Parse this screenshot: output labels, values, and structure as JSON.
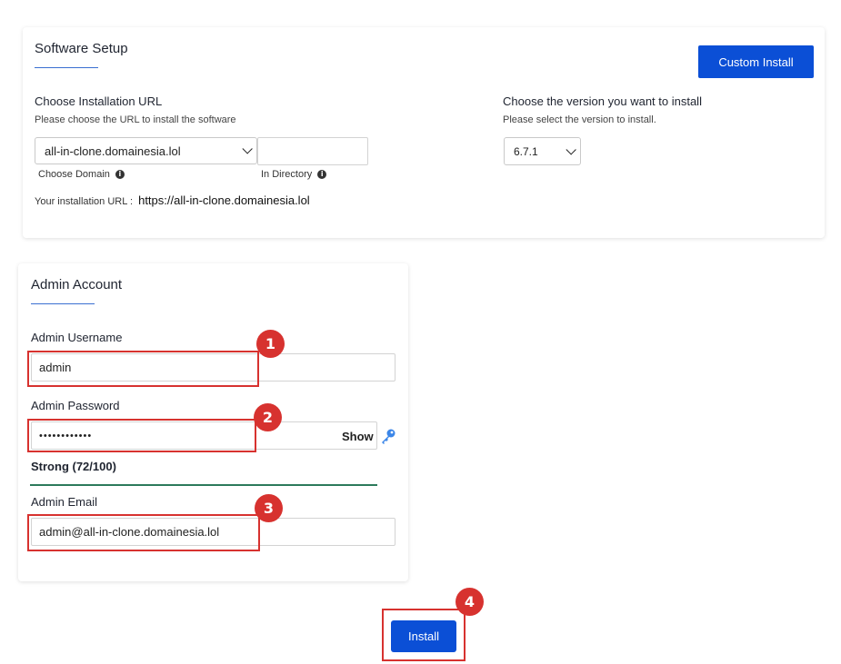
{
  "software_setup": {
    "title": "Software Setup",
    "custom_install_label": "Custom Install",
    "url_section": {
      "title": "Choose Installation URL",
      "subtitle": "Please choose the URL to install the software",
      "domain_value": "all-in-clone.domainesia.lol",
      "domain_label": "Choose Domain",
      "directory_value": "",
      "directory_label": "In Directory",
      "installation_url_label": "Your installation URL :",
      "installation_url": "https://all-in-clone.domainesia.lol"
    },
    "version_section": {
      "title": "Choose the version you want to install",
      "subtitle": "Please select the version to install.",
      "version_value": "6.7.1"
    }
  },
  "admin_account": {
    "title": "Admin Account",
    "username_label": "Admin Username",
    "username_value": "admin",
    "password_label": "Admin Password",
    "password_value": "••••••••••••",
    "show_label": "Show",
    "strength_text": "Strong (72/100)",
    "strength_color": "#2c7a5b",
    "email_label": "Admin Email",
    "email_value": "admin@all-in-clone.domainesia.lol"
  },
  "install_label": "Install",
  "annotations": [
    "1",
    "2",
    "3",
    "4"
  ],
  "colors": {
    "primary": "#0b4fd6",
    "highlight": "#d7322f"
  },
  "icons": {
    "info": "info-icon",
    "key": "key-icon",
    "chevron": "chevron-down-icon"
  }
}
